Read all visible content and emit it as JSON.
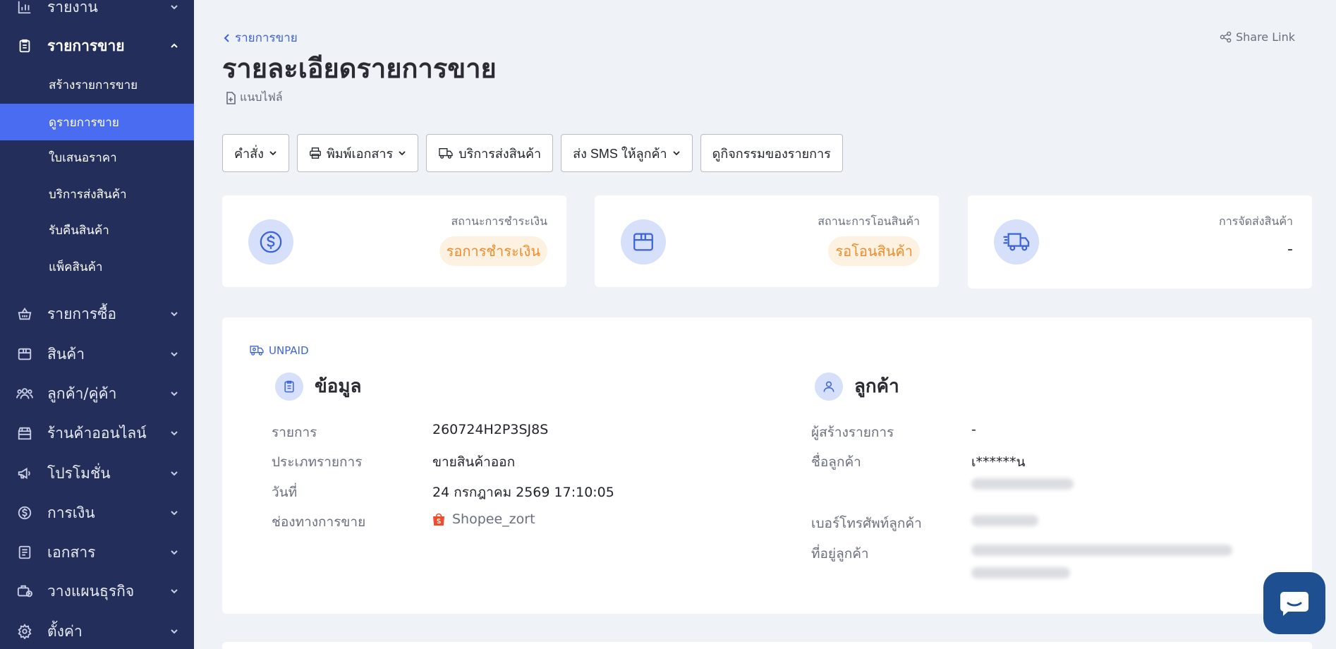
{
  "sidebar": {
    "top_item": {
      "label": "รายงาน",
      "icon": "bar-chart-icon"
    },
    "sales": {
      "label": "รายการขาย",
      "icon": "clipboard-icon",
      "sub_items": [
        {
          "label": "สร้างรายการขาย"
        },
        {
          "label": "ดูรายการขาย",
          "active": true
        },
        {
          "label": "ใบเสนอราคา"
        },
        {
          "label": "บริการส่งสินค้า"
        },
        {
          "label": "รับคืนสินค้า"
        },
        {
          "label": "แพ็คสินค้า"
        }
      ]
    },
    "items": [
      {
        "label": "รายการซื้อ",
        "icon": "basket-icon"
      },
      {
        "label": "สินค้า",
        "icon": "box-icon"
      },
      {
        "label": "ลูกค้า/คู่ค้า",
        "icon": "users-icon"
      },
      {
        "label": "ร้านค้าออนไลน์",
        "icon": "store-icon"
      },
      {
        "label": "โปรโมชั่น",
        "icon": "megaphone-icon"
      },
      {
        "label": "การเงิน",
        "icon": "dollar-icon"
      },
      {
        "label": "เอกสาร",
        "icon": "document-icon"
      },
      {
        "label": "วางแผนธุรกิจ",
        "icon": "briefcase-icon"
      },
      {
        "label": "ตั้งค่า",
        "icon": "gear-icon"
      }
    ]
  },
  "header": {
    "breadcrumb": "รายการขาย",
    "title": "รายละเอียดรายการขาย",
    "attach_label": "แนบไฟล์",
    "share_label": "Share Link"
  },
  "toolbar": {
    "command": "คำสั่ง",
    "print": "พิมพ์เอกสาร",
    "shipping": "บริการส่งสินค้า",
    "sms": "ส่ง SMS ให้ลูกค้า",
    "activity": "ดูกิจกรรมของรายการ"
  },
  "status": {
    "payment": {
      "label": "สถานะการชำระเงิน",
      "value": "รอการชำระเงิน"
    },
    "transfer": {
      "label": "สถานะการโอนสินค้า",
      "value": "รอโอนสินค้า"
    },
    "delivery": {
      "label": "การจัดส่งสินค้า",
      "value": "-"
    }
  },
  "detail": {
    "payment_tag": "UNPAID",
    "info": {
      "title": "ข้อมูล",
      "rows": [
        {
          "label": "รายการ",
          "value": "260724H2P3SJ8S"
        },
        {
          "label": "ประเภทรายการ",
          "value": "ขายสินค้าออก"
        },
        {
          "label": "วันที่",
          "value": "24 กรกฎาคม 2569 17:10:05"
        },
        {
          "label": "ช่องทางการขาย",
          "value": "Shopee_zort"
        }
      ]
    },
    "customer": {
      "title": "ลูกค้า",
      "rows": [
        {
          "label": "ผู้สร้างรายการ",
          "value": "-"
        },
        {
          "label": "ชื่อลูกค้า",
          "value": "เ******น"
        },
        {
          "label": "เบอร์โทรศัพท์ลูกค้า",
          "value": ""
        },
        {
          "label": "ที่อยู่ลูกค้า",
          "value": ""
        }
      ]
    }
  },
  "colors": {
    "sidebar_bg": "#232e5a",
    "active_item": "#4a6cf0",
    "accent": "#3d63d8",
    "pending": "#f08c2b",
    "chat": "#1d4f91"
  }
}
